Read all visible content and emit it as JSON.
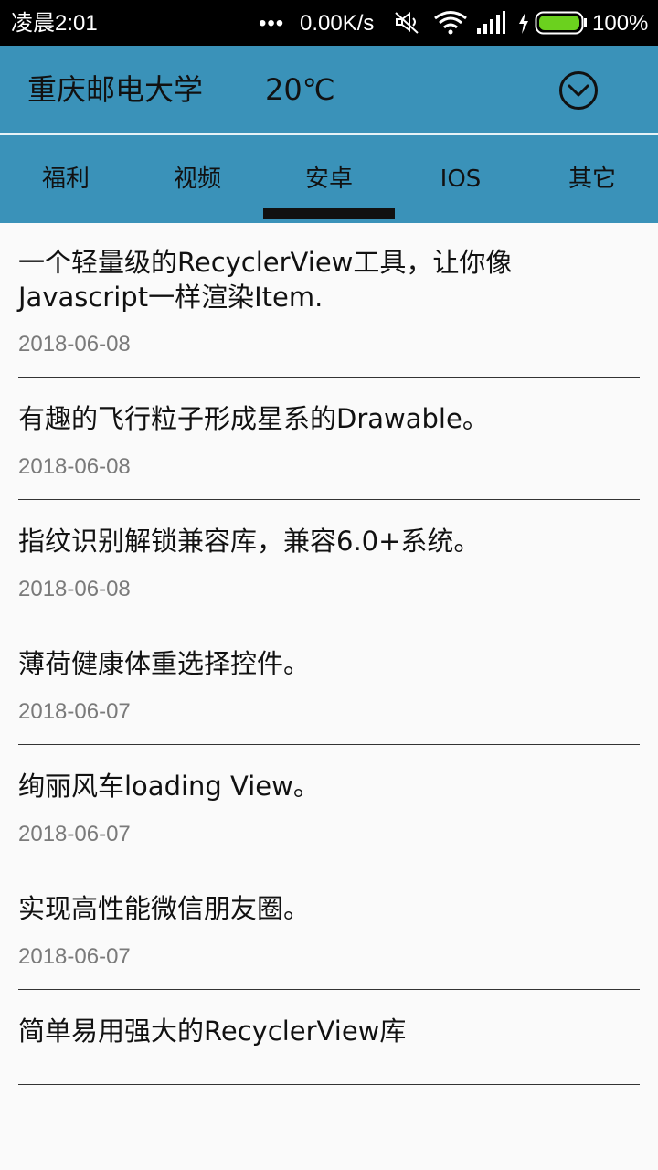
{
  "status_bar": {
    "time": "凌晨2:01",
    "dots": "•••",
    "network_speed": "0.00K/s",
    "icons": [
      "mute-icon",
      "wifi-icon",
      "signal-icon",
      "charging-icon",
      "battery-icon"
    ],
    "battery_percent": "100%"
  },
  "header": {
    "city": "重庆邮电大学",
    "temperature": "20℃",
    "dropdown_icon": "chevron-down-circle-icon"
  },
  "tabs": [
    {
      "label": "福利",
      "active": false
    },
    {
      "label": "视频",
      "active": false
    },
    {
      "label": "安卓",
      "active": true
    },
    {
      "label": "IOS",
      "active": false
    },
    {
      "label": "其它",
      "active": false
    }
  ],
  "articles": [
    {
      "title": "一个轻量级的RecyclerView工具，让你像Javascript一样渲染Item.",
      "date": "2018-06-08"
    },
    {
      "title": "有趣的飞行粒子形成星系的Drawable。",
      "date": "2018-06-08"
    },
    {
      "title": "指纹识别解锁兼容库，兼容6.0+系统。",
      "date": "2018-06-08"
    },
    {
      "title": "薄荷健康体重选择控件。",
      "date": "2018-06-07"
    },
    {
      "title": "绚丽风车loading View。",
      "date": "2018-06-07"
    },
    {
      "title": "实现高性能微信朋友圈。",
      "date": "2018-06-07"
    },
    {
      "title": "简单易用强大的RecyclerView库",
      "date": ""
    }
  ],
  "colors": {
    "primary": "#3a92b9",
    "background": "#fafafa",
    "text": "#111111",
    "date_text": "#7a7a7a",
    "battery_green": "#6bd11e"
  }
}
